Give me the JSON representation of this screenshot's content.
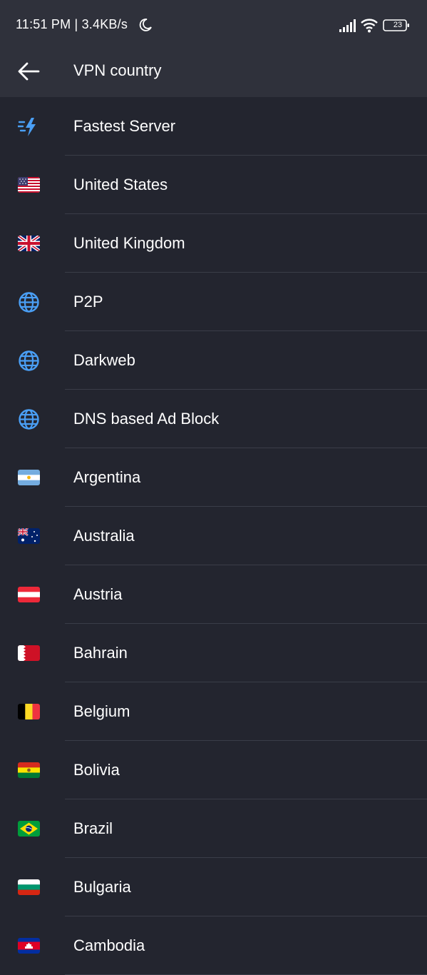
{
  "status_bar": {
    "time_speed": "11:51 PM | 3.4KB/s",
    "battery": "23"
  },
  "app_bar": {
    "title": "VPN country"
  },
  "countries": [
    {
      "label": "Fastest Server",
      "icon": "lightning-icon"
    },
    {
      "label": "United States",
      "icon": "flag-us-icon"
    },
    {
      "label": "United Kingdom",
      "icon": "flag-uk-icon"
    },
    {
      "label": "P2P",
      "icon": "globe-icon"
    },
    {
      "label": "Darkweb",
      "icon": "globe-icon"
    },
    {
      "label": "DNS based Ad Block",
      "icon": "globe-icon"
    },
    {
      "label": "Argentina",
      "icon": "flag-argentina-icon"
    },
    {
      "label": "Australia",
      "icon": "flag-australia-icon"
    },
    {
      "label": "Austria",
      "icon": "flag-austria-icon"
    },
    {
      "label": "Bahrain",
      "icon": "flag-bahrain-icon"
    },
    {
      "label": "Belgium",
      "icon": "flag-belgium-icon"
    },
    {
      "label": "Bolivia",
      "icon": "flag-bolivia-icon"
    },
    {
      "label": "Brazil",
      "icon": "flag-brazil-icon"
    },
    {
      "label": "Bulgaria",
      "icon": "flag-bulgaria-icon"
    },
    {
      "label": "Cambodia",
      "icon": "flag-cambodia-icon"
    }
  ],
  "colors": {
    "background": "#23252f",
    "header": "#2f313b",
    "accent": "#4a9ff5"
  }
}
